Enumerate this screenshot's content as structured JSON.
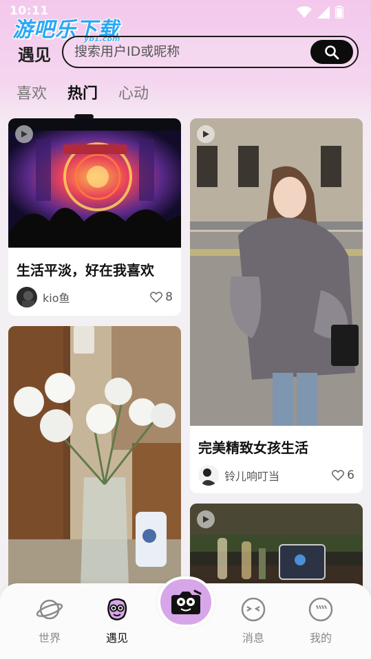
{
  "status_bar": {
    "time": "10:11"
  },
  "watermark": {
    "text": "游吧乐下载",
    "sub": "yb1.com"
  },
  "header": {
    "title": "遇见",
    "search_placeholder": "搜索用户ID或昵称"
  },
  "tabs": [
    {
      "label": "喜欢"
    },
    {
      "label": "热门"
    },
    {
      "label": "心动"
    }
  ],
  "feed": [
    {
      "title": "生活平淡，好在我喜欢",
      "author": "kio鱼",
      "likes": "8",
      "video": true
    },
    {
      "title": "完美精致女孩生活",
      "author": "铃儿响叮当",
      "likes": "6",
      "video": true
    },
    {
      "title": "",
      "author": "",
      "likes": "",
      "video": false
    },
    {
      "title": "",
      "author": "",
      "likes": "",
      "video": true
    }
  ],
  "bottom_nav": [
    {
      "label": "世界",
      "icon": "planet-icon"
    },
    {
      "label": "遇见",
      "icon": "meet-mascot-icon",
      "active": true
    },
    {
      "label": "",
      "icon": "camera-icon"
    },
    {
      "label": "消息",
      "icon": "message-face-icon"
    },
    {
      "label": "我的",
      "icon": "profile-face-icon"
    }
  ],
  "colors": {
    "accent": "#d7a6e9",
    "search_button": "#0c0c0c"
  }
}
